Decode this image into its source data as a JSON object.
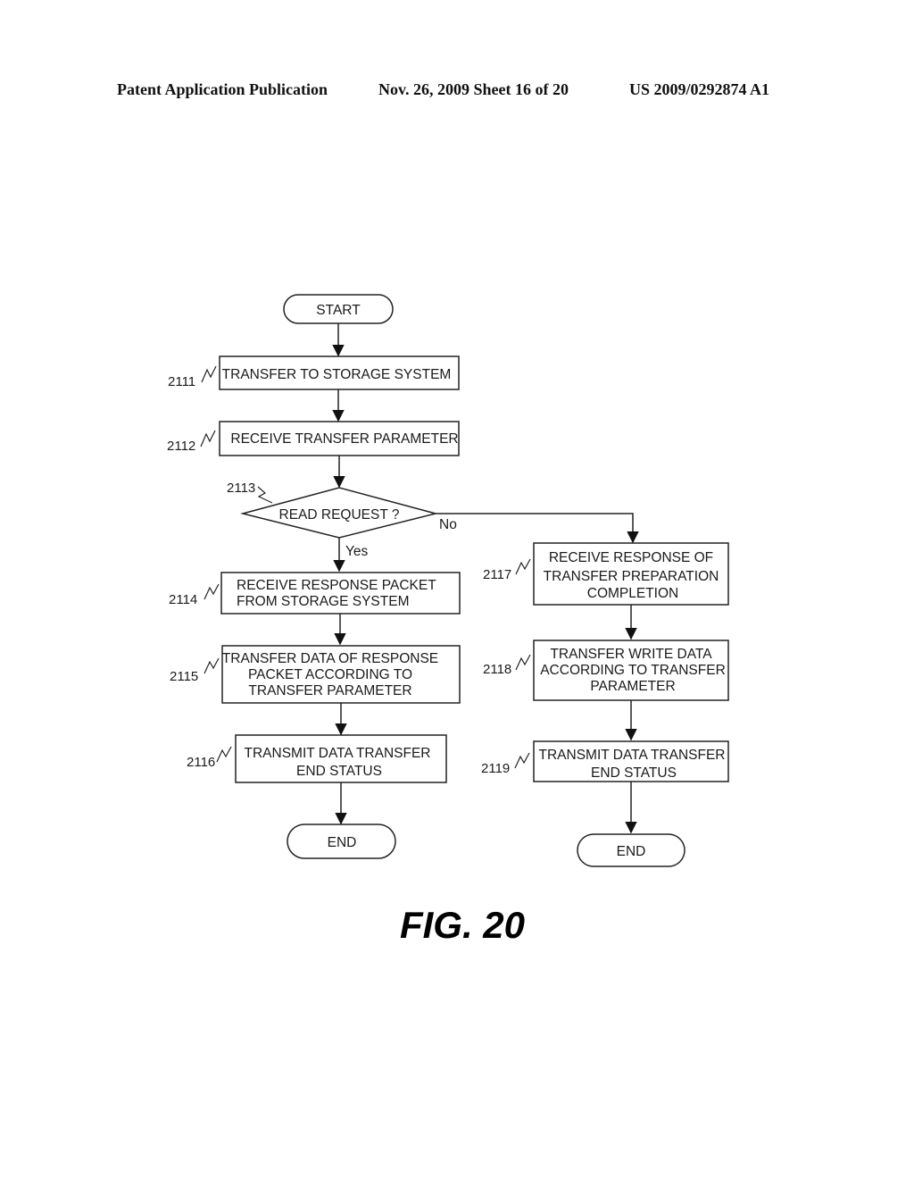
{
  "header": {
    "publication": "Patent Application Publication",
    "date_sheet": "Nov. 26, 2009   Sheet 16 of 20",
    "patent_number": "US 2009/0292874 A1"
  },
  "flowchart": {
    "start": "START",
    "steps": {
      "s2111": {
        "ref": "2111",
        "lines": [
          "TRANSFER TO STORAGE SYSTEM"
        ]
      },
      "s2112": {
        "ref": "2112",
        "lines": [
          "RECEIVE TRANSFER PARAMETER"
        ]
      },
      "s2113": {
        "ref": "2113",
        "lines": [
          "READ REQUEST ?"
        ]
      },
      "s2114": {
        "ref": "2114",
        "lines": [
          "RECEIVE RESPONSE PACKET",
          "FROM STORAGE SYSTEM"
        ]
      },
      "s2115": {
        "ref": "2115",
        "lines": [
          "TRANSFER DATA OF RESPONSE",
          "PACKET ACCORDING TO",
          "TRANSFER PARAMETER"
        ]
      },
      "s2116": {
        "ref": "2116",
        "lines": [
          "TRANSMIT DATA TRANSFER",
          "END STATUS"
        ]
      },
      "s2117": {
        "ref": "2117",
        "lines": [
          "RECEIVE RESPONSE OF",
          "TRANSFER PREPARATION",
          "COMPLETION"
        ]
      },
      "s2118": {
        "ref": "2118",
        "lines": [
          "TRANSFER WRITE DATA",
          "ACCORDING TO TRANSFER",
          "PARAMETER"
        ]
      },
      "s2119": {
        "ref": "2119",
        "lines": [
          "TRANSMIT DATA TRANSFER",
          "END STATUS"
        ]
      }
    },
    "branch_yes": "Yes",
    "branch_no": "No",
    "end_left": "END",
    "end_right": "END"
  },
  "caption": "FIG. 20"
}
